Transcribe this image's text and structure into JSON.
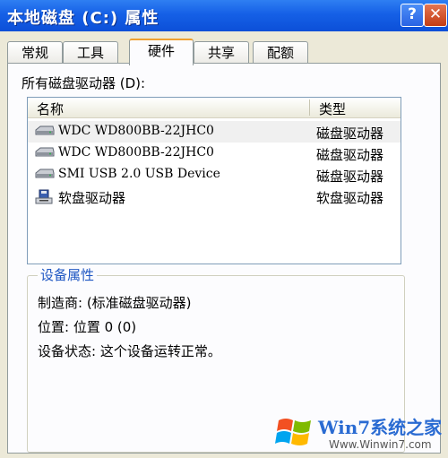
{
  "window": {
    "title": "本地磁盘 (C:) 属性",
    "help_label": "?",
    "close_label": "✕"
  },
  "tabs": [
    {
      "label": "常规"
    },
    {
      "label": "工具"
    },
    {
      "label": "硬件",
      "active": true
    },
    {
      "label": "共享"
    },
    {
      "label": "配额"
    }
  ],
  "drives": {
    "label": "所有磁盘驱动器 (D):",
    "columns": {
      "name": "名称",
      "type": "类型"
    },
    "rows": [
      {
        "name": "WDC WD800BB-22JHC0",
        "type": "磁盘驱动器",
        "icon": "hard-disk-icon"
      },
      {
        "name": "WDC WD800BB-22JHC0",
        "type": "磁盘驱动器",
        "icon": "hard-disk-icon"
      },
      {
        "name": "SMI USB  2.0 USB Device",
        "type": "磁盘驱动器",
        "icon": "hard-disk-icon"
      },
      {
        "name": "软盘驱动器",
        "type": "软盘驱动器",
        "icon": "floppy-drive-icon"
      }
    ]
  },
  "device_properties": {
    "title": "设备属性",
    "manufacturer": "制造商: (标准磁盘驱动器)",
    "location": "位置: 位置 0 (0)",
    "status": "设备状态: 这个设备运转正常。"
  },
  "watermark": {
    "brand": "Win7系统之家",
    "url": "Www.Winwin7.com"
  },
  "colors": {
    "titlebar": "#0c4fd8",
    "dialog_bg": "#ece9d8",
    "group_title": "#1f57c3",
    "active_tab_accent": "#f0a030"
  }
}
